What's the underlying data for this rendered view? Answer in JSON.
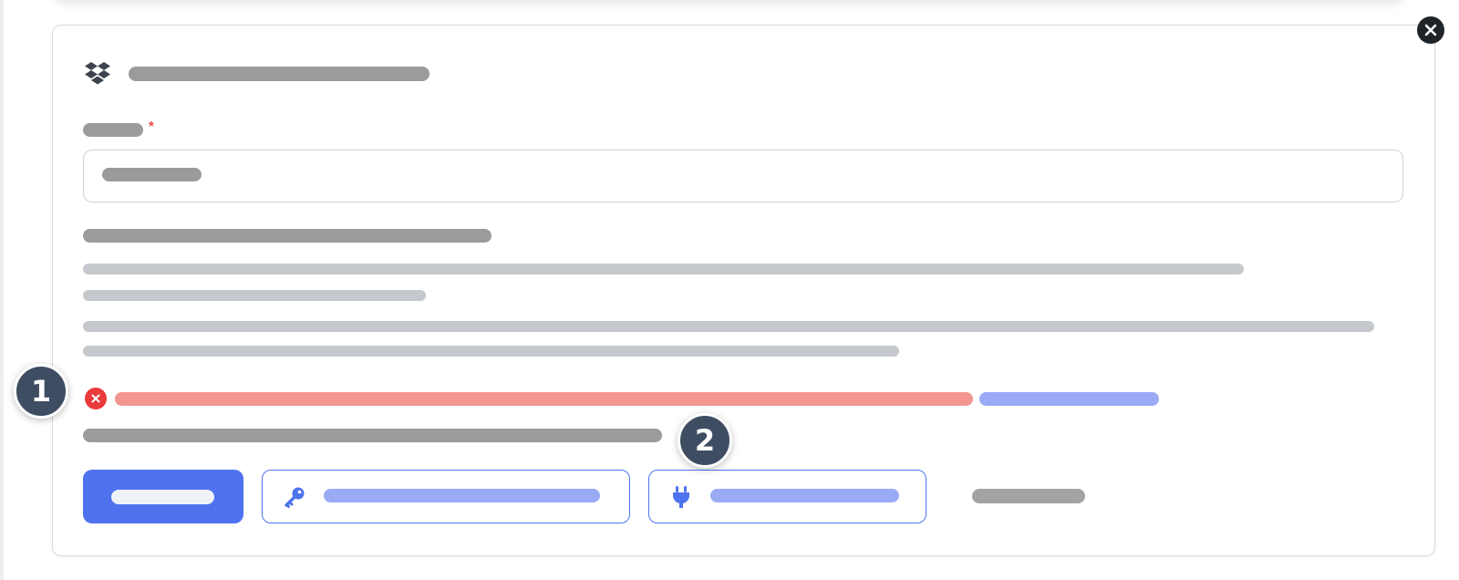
{
  "window": {
    "close_icon": "close-icon"
  },
  "card": {
    "provider_icon": "dropbox-icon",
    "required_marker": "*"
  },
  "error": {
    "icon": "error-x-icon"
  },
  "actions": {
    "credentials_icon": "key-icon",
    "connect_icon": "plug-icon"
  },
  "badges": [
    "1",
    "2"
  ],
  "colors": {
    "primary": "#4f73ee",
    "error": "#e93b3b",
    "badge": "#3f4d62",
    "error_text": "#f39690",
    "link_text": "#9aaaf5",
    "redacted_text": "#9b9b9b",
    "redacted_secondary": "#c5c8cc"
  }
}
